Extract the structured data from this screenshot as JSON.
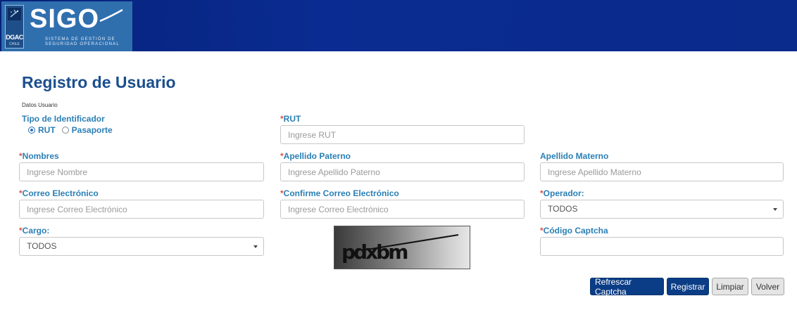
{
  "header": {
    "logo_abbrev": "DGAC",
    "logo_country": "CHILE",
    "app_name": "SIGO",
    "app_subtitle_line1": "SISTEMA DE GESTIÓN DE",
    "app_subtitle_line2": "SEGURIDAD OPERACIONAL"
  },
  "page": {
    "title": "Registro de Usuario",
    "section": "Datos Usuario"
  },
  "form": {
    "id_type": {
      "label": "Tipo de Identificador",
      "options": [
        "RUT",
        "Pasaporte"
      ],
      "selected": "RUT"
    },
    "rut": {
      "label": "RUT",
      "placeholder": "Ingrese RUT",
      "required": "*"
    },
    "nombres": {
      "label": "Nombres",
      "placeholder": "Ingrese Nombre",
      "required": "*"
    },
    "apellido_paterno": {
      "label": "Apellido Paterno",
      "placeholder": "Ingrese Apellido Paterno",
      "required": "*"
    },
    "apellido_materno": {
      "label": "Apellido Materno",
      "placeholder": "Ingrese Apellido Materno"
    },
    "correo": {
      "label": "Correo Electrónico",
      "placeholder": "Ingrese Correo Electrónico",
      "required": "*"
    },
    "confirme_correo": {
      "label": "Confirme Correo Electrónico",
      "placeholder": "Ingrese Correo Electrónico",
      "required": "*"
    },
    "operador": {
      "label": "Operador:",
      "value": "TODOS",
      "required": "*"
    },
    "cargo": {
      "label": "Cargo:",
      "value": "TODOS",
      "required": "*"
    },
    "captcha": {
      "label": "Código Captcha",
      "image_text": "pdxbm",
      "value": "",
      "required": "*"
    }
  },
  "buttons": {
    "refresh": "Refrescar Captcha",
    "register": "Registrar",
    "clear": "Limpiar",
    "back": "Volver"
  },
  "colors": {
    "header_blue": "#0a2a8c",
    "label_blue": "#2a7fb5",
    "required_red": "#d9534f",
    "button_blue": "#0b3d86"
  }
}
